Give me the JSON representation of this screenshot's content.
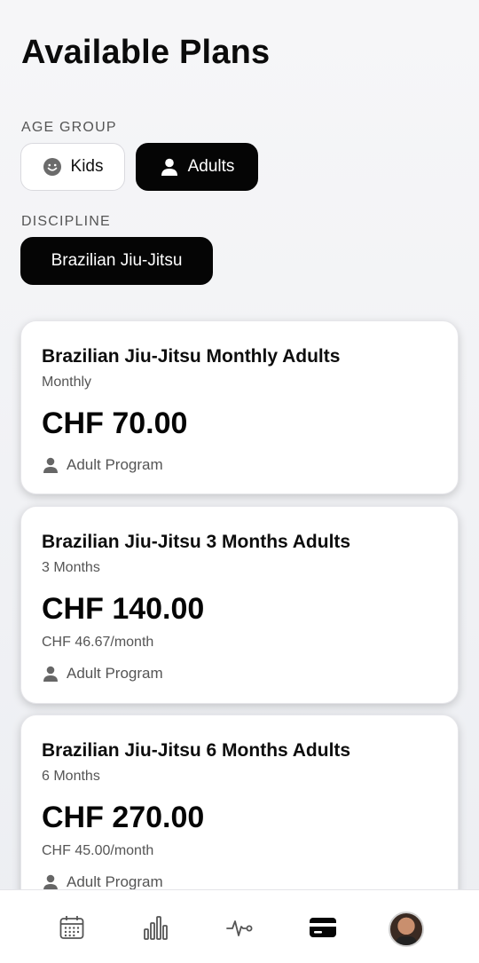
{
  "page": {
    "title": "Available Plans"
  },
  "filters": {
    "age_group_label": "AGE GROUP",
    "age_options": [
      {
        "label": "Kids",
        "icon": "smiley-icon",
        "selected": false
      },
      {
        "label": "Adults",
        "icon": "person-icon",
        "selected": true
      }
    ],
    "discipline_label": "DISCIPLINE",
    "discipline_options": [
      {
        "label": "Brazilian Jiu-Jitsu",
        "selected": true
      }
    ]
  },
  "plans": [
    {
      "title": "Brazilian Jiu-Jitsu Monthly Adults",
      "period": "Monthly",
      "price": "CHF 70.00",
      "per_month": "",
      "program": "Adult Program"
    },
    {
      "title": "Brazilian Jiu-Jitsu 3 Months Adults",
      "period": "3 Months",
      "price": "CHF 140.00",
      "per_month": "CHF 46.67/month",
      "program": "Adult Program"
    },
    {
      "title": "Brazilian Jiu-Jitsu 6 Months Adults",
      "period": "6 Months",
      "price": "CHF 270.00",
      "per_month": "CHF 45.00/month",
      "program": "Adult Program"
    }
  ],
  "nav": {
    "items": [
      {
        "icon": "calendar-icon",
        "active": false
      },
      {
        "icon": "bar-chart-icon",
        "active": false
      },
      {
        "icon": "activity-icon",
        "active": false
      },
      {
        "icon": "credit-card-icon",
        "active": true
      },
      {
        "icon": "profile-avatar",
        "active": false
      }
    ]
  },
  "colors": {
    "accent": "#050505",
    "muted_text": "#555555",
    "background": "#f2f3f6"
  }
}
